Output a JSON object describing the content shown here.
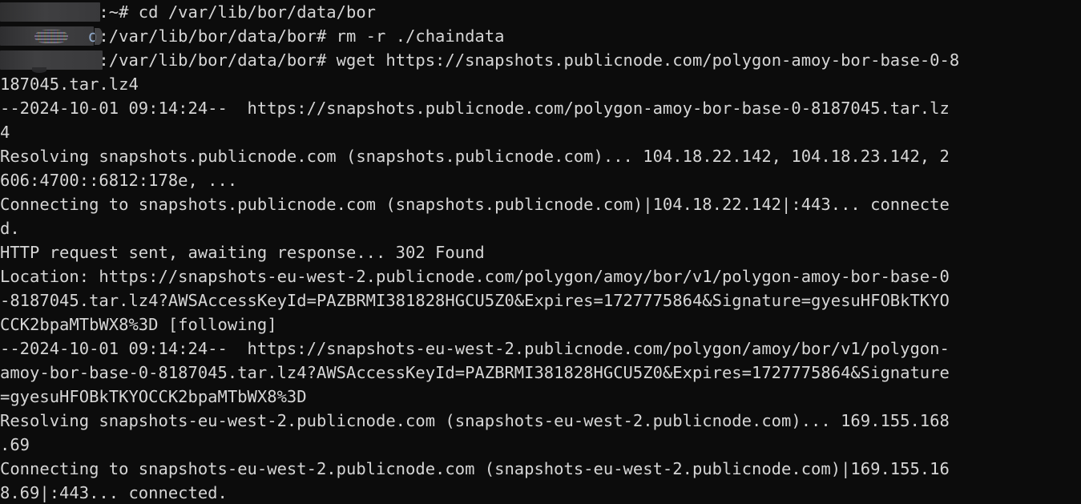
{
  "terminal": {
    "title": "Terminal",
    "background_color": "#0c0c0c",
    "foreground_color": "#d6d6d6",
    "columns": 112,
    "font_size_px": 20.5,
    "line_height_px": 30,
    "redaction": {
      "note": "hostname portion of the shell prompt is covered by a gray redaction block",
      "block_color": "#3a3a3c",
      "visible_glyph_after_block_line2": "o"
    }
  },
  "prompt": {
    "line1_suffix": ":~# ",
    "line2_suffix": ":/var/lib/bor/data/bor# ",
    "line3_suffix": ":/var/lib/bor/data/bor# "
  },
  "commands": {
    "cd": "cd /var/lib/bor/data/bor",
    "rm": "rm -r ./chaindata",
    "wget": "wget https://snapshots.publicnode.com/polygon-amoy-bor-base-0-8187045.tar.lz4"
  },
  "lines": [
    {
      "type": "prompt",
      "redact": 1,
      "prompt": ":~# ",
      "text": "cd /var/lib/bor/data/bor"
    },
    {
      "type": "prompt",
      "redact": 2,
      "prompt": ":/var/lib/bor/data/bor# ",
      "text": "rm -r ./chaindata"
    },
    {
      "type": "prompt",
      "redact": 3,
      "prompt": ":/var/lib/bor/data/bor# ",
      "text": "wget https://snapshots.publicnode.com/polygon-amoy-bor-base-0-8"
    },
    {
      "type": "output",
      "text": "187045.tar.lz4"
    },
    {
      "type": "output",
      "text": "--2024-10-01 09:14:24--  https://snapshots.publicnode.com/polygon-amoy-bor-base-0-8187045.tar.lz"
    },
    {
      "type": "output",
      "text": "4"
    },
    {
      "type": "output",
      "text": "Resolving snapshots.publicnode.com (snapshots.publicnode.com)... 104.18.22.142, 104.18.23.142, 2"
    },
    {
      "type": "output",
      "text": "606:4700::6812:178e, ..."
    },
    {
      "type": "output",
      "text": "Connecting to snapshots.publicnode.com (snapshots.publicnode.com)|104.18.22.142|:443... connecte"
    },
    {
      "type": "output",
      "text": "d."
    },
    {
      "type": "output",
      "text": "HTTP request sent, awaiting response... 302 Found"
    },
    {
      "type": "output",
      "text": "Location: https://snapshots-eu-west-2.publicnode.com/polygon/amoy/bor/v1/polygon-amoy-bor-base-0"
    },
    {
      "type": "output",
      "text": "-8187045.tar.lz4?AWSAccessKeyId=PAZBRMI381828HGCU5Z0&Expires=1727775864&Signature=gyesuHFOBkTKYO"
    },
    {
      "type": "output",
      "text": "CCK2bpaMTbWX8%3D [following]"
    },
    {
      "type": "output",
      "text": "--2024-10-01 09:14:24--  https://snapshots-eu-west-2.publicnode.com/polygon/amoy/bor/v1/polygon-"
    },
    {
      "type": "output",
      "text": "amoy-bor-base-0-8187045.tar.lz4?AWSAccessKeyId=PAZBRMI381828HGCU5Z0&Expires=1727775864&Signature"
    },
    {
      "type": "output",
      "text": "=gyesuHFOBkTKYOCCK2bpaMTbWX8%3D"
    },
    {
      "type": "output",
      "text": "Resolving snapshots-eu-west-2.publicnode.com (snapshots-eu-west-2.publicnode.com)... 169.155.168"
    },
    {
      "type": "output",
      "text": ".69"
    },
    {
      "type": "output",
      "text": "Connecting to snapshots-eu-west-2.publicnode.com (snapshots-eu-west-2.publicnode.com)|169.155.16"
    },
    {
      "type": "output",
      "text": "8.69|:443... connected."
    }
  ]
}
